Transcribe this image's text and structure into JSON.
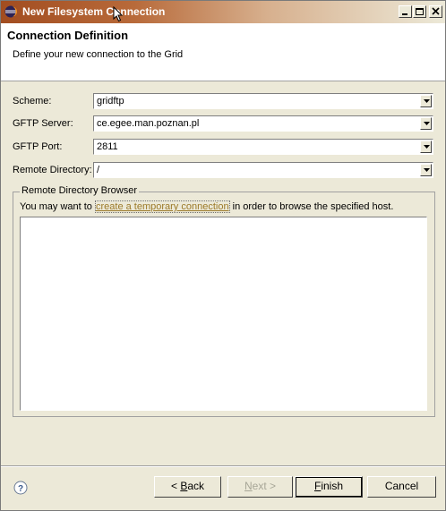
{
  "window": {
    "title": "New Filesystem Connection",
    "controls": [
      "minimize-icon",
      "maximize-icon",
      "close-icon"
    ]
  },
  "header": {
    "title": "Connection Definition",
    "description": "Define your new connection to the Grid"
  },
  "form": {
    "scheme_label": "Scheme:",
    "scheme_value": "gridftp",
    "server_label": "GFTP Server:",
    "server_value": "ce.egee.man.poznan.pl",
    "port_label": "GFTP Port:",
    "port_value": "2811",
    "dir_label": "Remote Directory:",
    "dir_value": "/"
  },
  "browser": {
    "group_title": "Remote Directory Browser",
    "text_before": "You may want to ",
    "link_text": "create a temporary connection",
    "text_after": " in order to browse the specified host."
  },
  "buttons": {
    "back_prefix": "< ",
    "back_mnemonic": "B",
    "back_rest": "ack",
    "next_mnemonic": "N",
    "next_rest": "ext >",
    "finish_mnemonic": "F",
    "finish_rest": "inish",
    "cancel": "Cancel"
  },
  "colors": {
    "title_gradient_start": "#a24d20",
    "link": "#9c7a29",
    "dialog_bg": "#ece9d8"
  }
}
